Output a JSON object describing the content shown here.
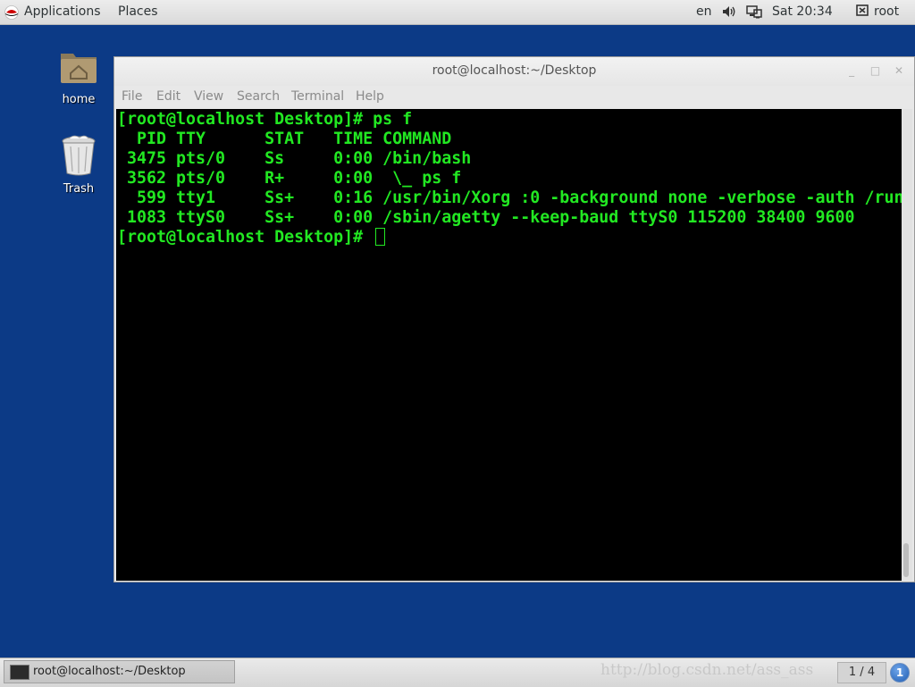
{
  "top_panel": {
    "applications": "Applications",
    "places": "Places",
    "language": "en",
    "clock": "Sat 20:34",
    "user": "root"
  },
  "desktop": {
    "icons": [
      {
        "label": "home",
        "icon": "home-folder-icon"
      },
      {
        "label": "Trash",
        "icon": "trash-icon"
      }
    ]
  },
  "terminal": {
    "title": "root@localhost:~/Desktop",
    "menu": [
      "File",
      "Edit",
      "View",
      "Search",
      "Terminal",
      "Help"
    ],
    "lines": [
      "[root@localhost Desktop]# ps f",
      "  PID TTY      STAT   TIME COMMAND",
      " 3475 pts/0    Ss     0:00 /bin/bash",
      " 3562 pts/0    R+     0:00  \\_ ps f",
      "  599 tty1     Ss+    0:16 /usr/bin/Xorg :0 -background none -verbose -auth /run",
      " 1083 ttyS0    Ss+    0:00 /sbin/agetty --keep-baud ttyS0 115200 38400 9600"
    ],
    "prompt": "[root@localhost Desktop]# ",
    "text_color": "#22e822",
    "background": "#000000"
  },
  "bottom_panel": {
    "task_label": "root@localhost:~/Desktop",
    "watermark": "http://blog.csdn.net/ass_ass",
    "workspace": "1 / 4",
    "notification_count": "1"
  }
}
